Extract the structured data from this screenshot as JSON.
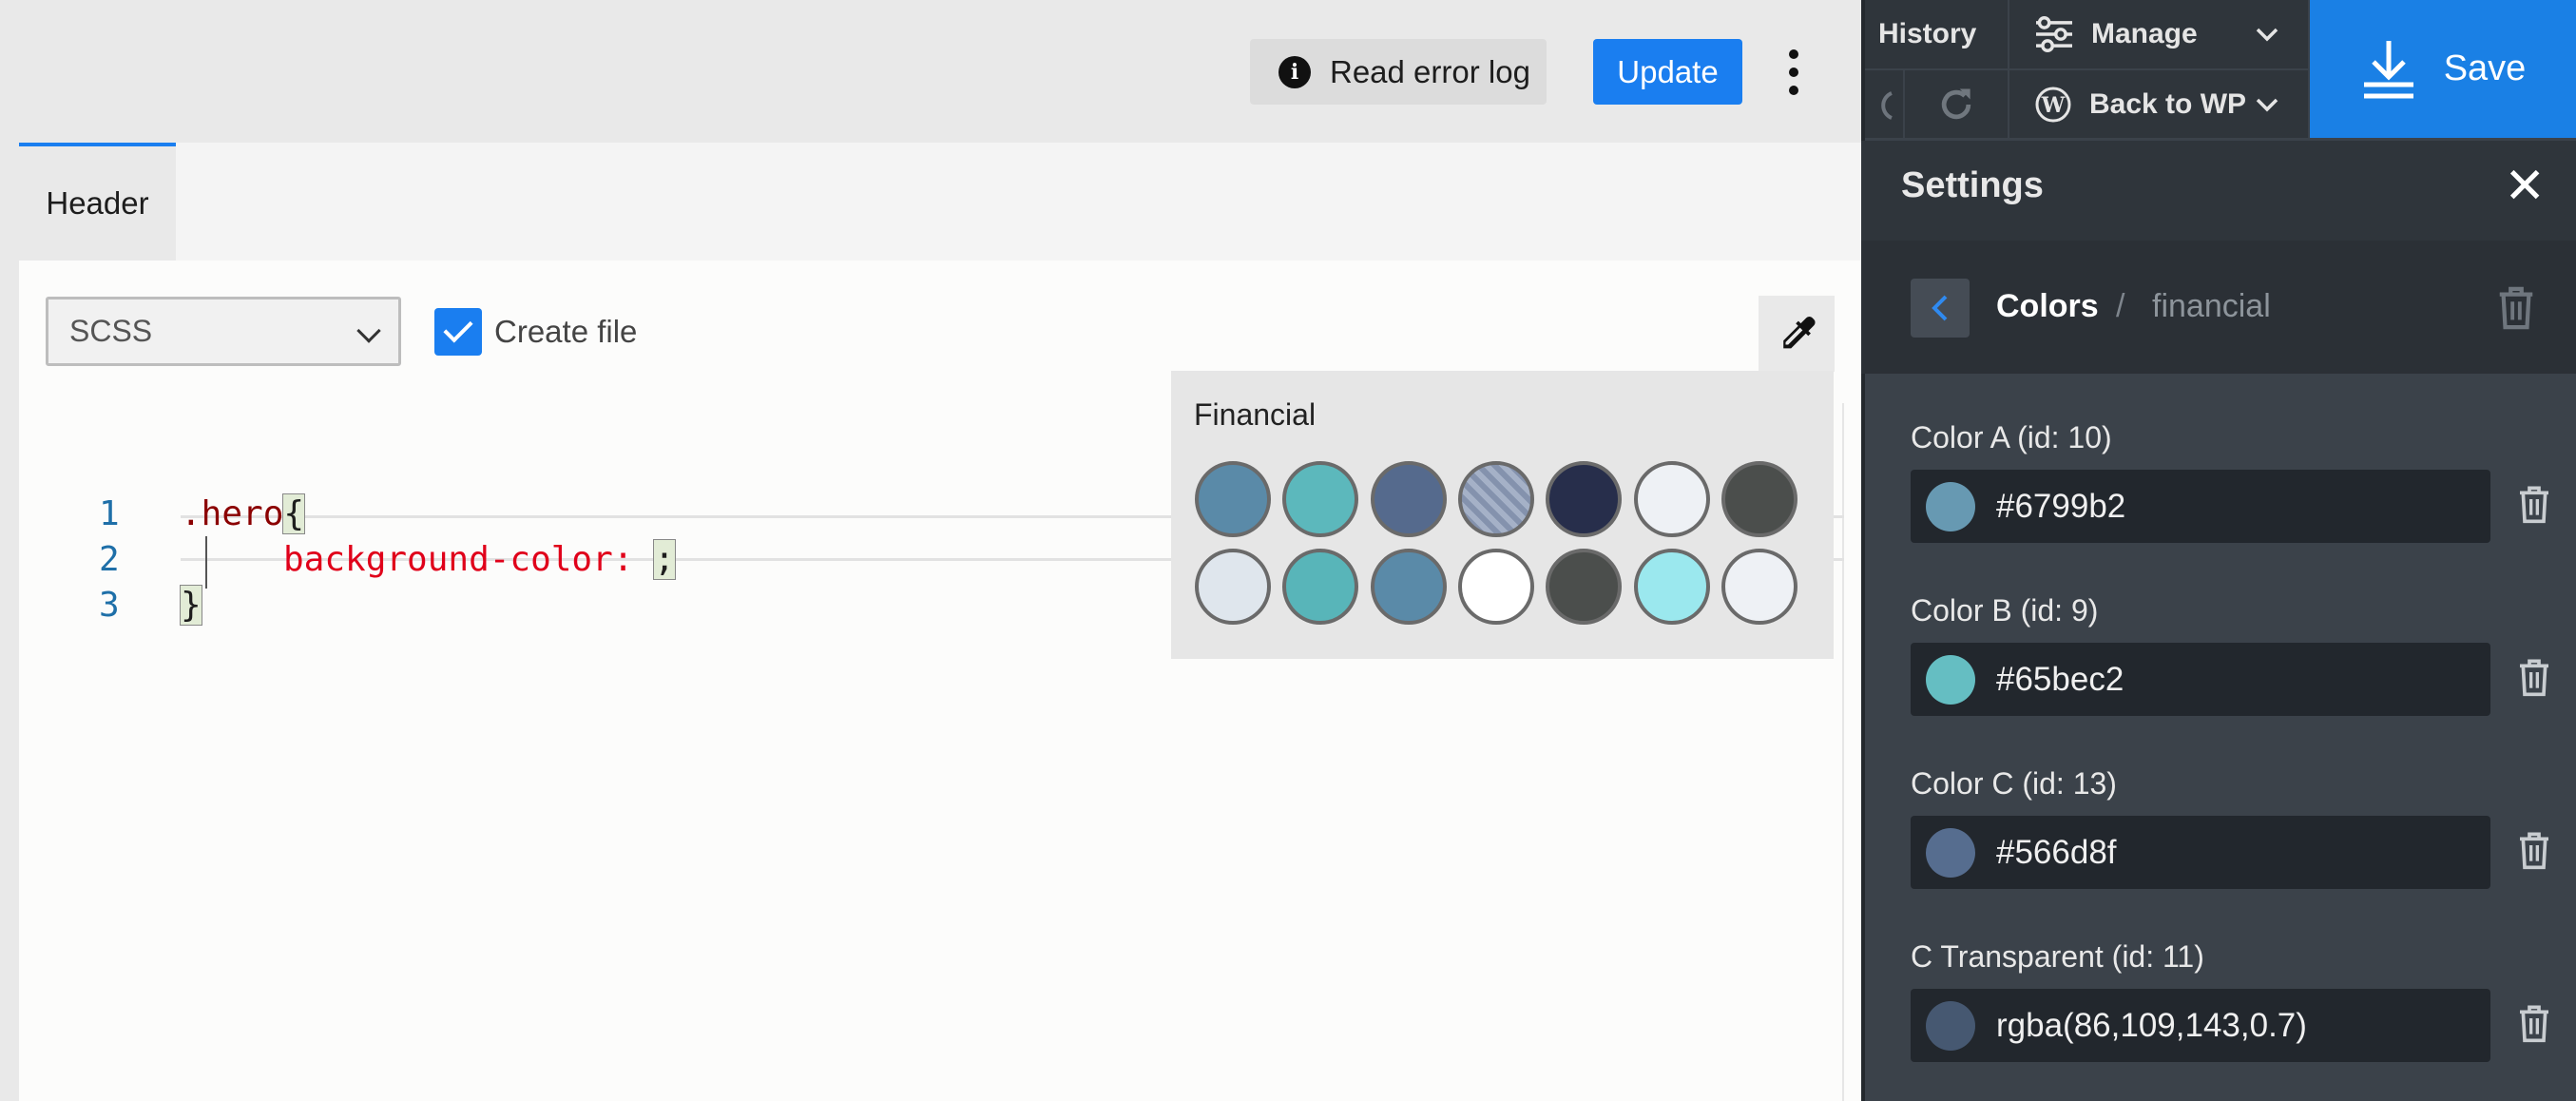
{
  "toolbar": {
    "read_error_log": "Read error log",
    "update": "Update"
  },
  "tabs": [
    {
      "label": "Header",
      "active": true
    }
  ],
  "editor": {
    "language": "SCSS",
    "create_file_label": "Create file",
    "create_file_checked": true,
    "line_numbers": [
      "1",
      "2",
      "3"
    ],
    "code": {
      "line1_selector": ".hero",
      "line1_brace": "{",
      "line2_prop": "background-color:",
      "line2_semicolon": ";",
      "line3_brace": "}"
    }
  },
  "palette_popup": {
    "title": "Financial",
    "swatches": [
      "#5a8aa8",
      "#5cb8bc",
      "#556a8d",
      "striped",
      "#272e4b",
      "#eef1f5",
      "#4b4e4c",
      "#dfe6ed",
      "#58b5b9",
      "#5a8aa8",
      "#ffffff",
      "#4b4e4c",
      "#9be8ee",
      "#eef1f5"
    ]
  },
  "sidebar": {
    "history": "History",
    "manage": "Manage",
    "back_to_wp": "Back to WP",
    "save": "Save",
    "settings_title": "Settings",
    "breadcrumb": {
      "section": "Colors",
      "separator": "/",
      "current": "financial"
    },
    "colors": [
      {
        "label": "Color A (id: 10)",
        "value": "#6799b2",
        "swatch": "#6799b2"
      },
      {
        "label": "Color B (id: 9)",
        "value": "#65bec2",
        "swatch": "#65bec2"
      },
      {
        "label": "Color C (id: 13)",
        "value": "#566d8f",
        "swatch": "#566d8f"
      },
      {
        "label": "C Transparent (id: 11)",
        "value": "rgba(86,109,143,0.7)",
        "swatch": "rgba(86,109,143,0.7)"
      }
    ]
  },
  "theme": {
    "accent": "#1a7ef0",
    "sidebar_bg": "#3b424a",
    "error": "#f26b6b"
  }
}
